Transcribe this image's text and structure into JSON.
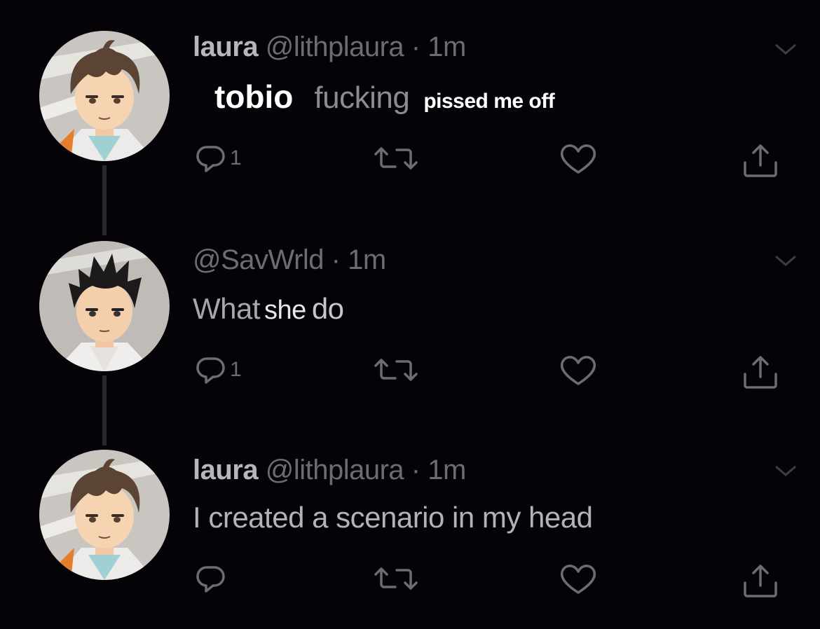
{
  "tweets": [
    {
      "name": "laura",
      "handle": "@lithplaura",
      "separator": "·",
      "time": "1m",
      "body_parts": [
        "tobio",
        "fucking",
        "pissed me off"
      ],
      "reply_count": "1",
      "avatar_character": "brown-haired anime boy"
    },
    {
      "name": "",
      "handle": "@SavWrld",
      "separator": "·",
      "time": "1m",
      "body_parts": [
        "What",
        "she",
        "do"
      ],
      "reply_count": "1",
      "avatar_character": "black-haired anime boy"
    },
    {
      "name": "laura",
      "handle": "@lithplaura",
      "separator": "·",
      "time": "1m",
      "body_text": "I created a scenario in my head",
      "reply_count": "",
      "avatar_character": "brown-haired anime boy"
    }
  ],
  "icons": {
    "reply": "reply-bubble-icon",
    "retweet": "retweet-icon",
    "like": "heart-icon",
    "share": "share-icon",
    "menu": "chevron-down-icon"
  },
  "colors": {
    "background": "#050307",
    "name": "#b9b5bd",
    "secondary": "#6f6b75",
    "overlay_text": "#ffffff"
  }
}
